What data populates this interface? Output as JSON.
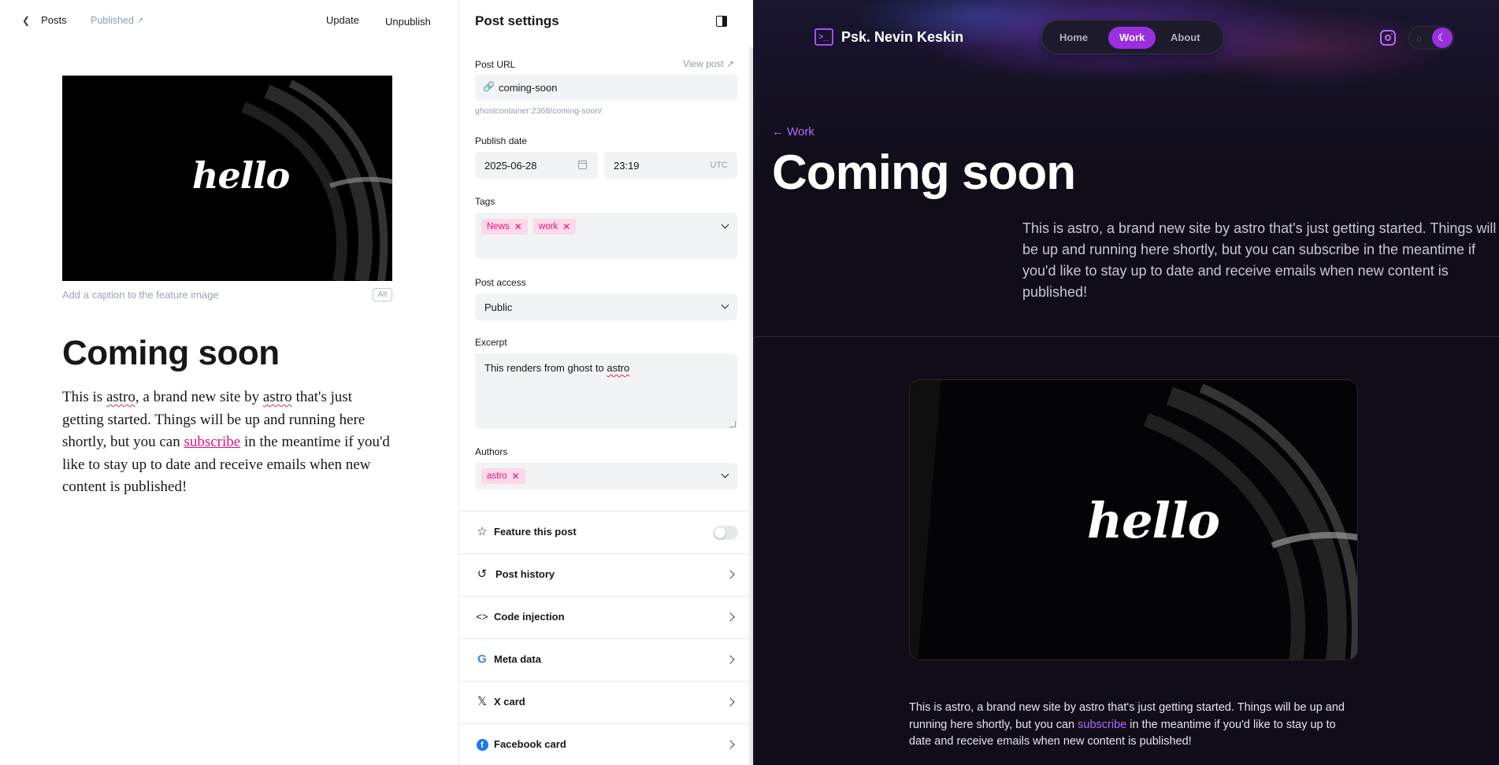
{
  "editor": {
    "back_label": "Posts",
    "status_label": "Published",
    "update_label": "Update",
    "unpublish_label": "Unpublish",
    "feature_image_text": "hello",
    "caption_placeholder": "Add a caption to the feature image",
    "alt_label": "Alt",
    "title": "Coming soon",
    "body": {
      "p1": "This is ",
      "w1": "astro",
      "p2": ", a brand new site by ",
      "w2": "astro",
      "p3": " that's just getting started. Things will be up and running here shortly, but you can ",
      "link": "subscribe",
      "p4": " in the meantime if you'd like to stay up to date and receive emails when new content is published!"
    }
  },
  "settings": {
    "title": "Post settings",
    "post_url_label": "Post URL",
    "view_post_label": "View post",
    "post_url_value": "coming-soon",
    "url_hint": "ghostcontainer:2368/coming-soon/",
    "publish_date_label": "Publish date",
    "date_value": "2025-06-28",
    "time_value": "23:19",
    "timezone": "UTC",
    "tags_label": "Tags",
    "tags": [
      "News",
      "work"
    ],
    "post_access_label": "Post access",
    "post_access_value": "Public",
    "excerpt_label": "Excerpt",
    "excerpt_pre": "This renders from ghost to ",
    "excerpt_word": "astro",
    "authors_label": "Authors",
    "authors": [
      "astro"
    ],
    "feature_label": "Feature this post",
    "feature_enabled": false,
    "rows": [
      {
        "label": "Post history",
        "icon": "history-icon"
      },
      {
        "label": "Code injection",
        "icon": "code-icon"
      },
      {
        "label": "Meta data",
        "icon": "google-icon"
      },
      {
        "label": "X card",
        "icon": "x-logo-icon"
      },
      {
        "label": "Facebook card",
        "icon": "facebook-icon"
      }
    ]
  },
  "preview": {
    "site_name": "Psk. Nevin Keskin",
    "nav": [
      "Home",
      "Work",
      "About"
    ],
    "active_nav": "Work",
    "back_label": "Work",
    "title": "Coming soon",
    "lead": "This is astro, a brand new site by astro that's just getting started. Things will be up and running here shortly, but you can subscribe in the meantime if you'd like to stay up to date and receive emails when new content is published!",
    "image_text": "hello",
    "body_pre": "This is astro, a brand new site by astro that's just getting started. Things will be up and running here shortly, but you can ",
    "body_link": "subscribe",
    "body_post": " in the meantime if you'd like to stay up to date and receive emails when new content is published!"
  },
  "colors": {
    "accent_pink": "#e2127a",
    "preview_purple": "#9a2fe0",
    "preview_bg": "#100d18"
  }
}
